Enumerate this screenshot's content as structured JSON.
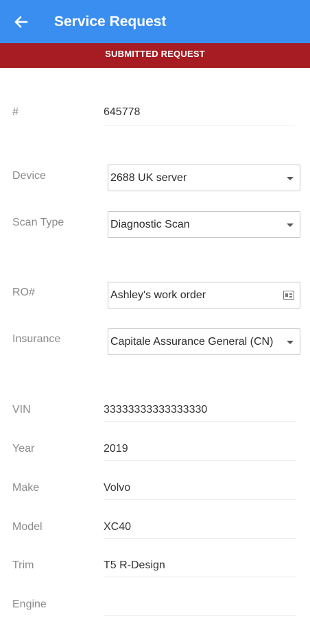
{
  "header": {
    "title": "Service Request",
    "back_icon": "arrow-left-icon"
  },
  "banner": {
    "text": "SUBMITTED REQUEST",
    "color": "#a61c22"
  },
  "request": {
    "label": "#",
    "value": "645778"
  },
  "form": {
    "device": {
      "label": "Device",
      "value": "2688 UK server"
    },
    "scan_type": {
      "label": "Scan Type",
      "value": "Diagnostic Scan"
    },
    "ro": {
      "label": "RO#",
      "value": "Ashley's work order"
    },
    "insurance": {
      "label": "Insurance",
      "value": "Capitale Assurance General (CN)"
    }
  },
  "vehicle": {
    "vin": {
      "label": "VIN",
      "value": "33333333333333330"
    },
    "year": {
      "label": "Year",
      "value": "2019"
    },
    "make": {
      "label": "Make",
      "value": "Volvo"
    },
    "model": {
      "label": "Model",
      "value": "XC40"
    },
    "trim": {
      "label": "Trim",
      "value": "T5 R-Design"
    },
    "engine": {
      "label": "Engine",
      "value": ""
    }
  },
  "theme": {
    "appbar": "#3a8ef0",
    "banner": "#a61c22"
  }
}
